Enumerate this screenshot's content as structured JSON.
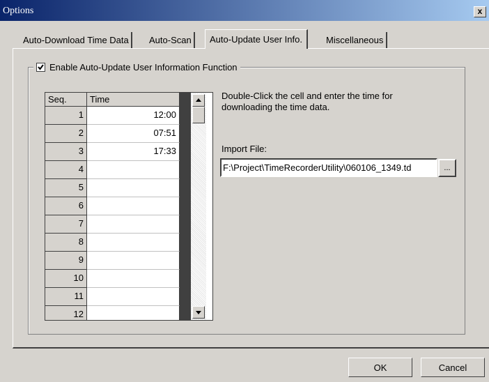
{
  "window": {
    "title": "Options",
    "close_label": "x"
  },
  "tabs": [
    {
      "label": "Auto-Download Time Data"
    },
    {
      "label": "Auto-Scan"
    },
    {
      "label": "Auto-Update User Info."
    },
    {
      "label": "Miscellaneous"
    }
  ],
  "active_tab": "Auto-Update User Info.",
  "group": {
    "label": "Enable Auto-Update User Information Function",
    "checked": true
  },
  "grid": {
    "headers": {
      "seq": "Seq.",
      "time": "Time"
    },
    "rows": [
      {
        "seq": "1",
        "time": "12:00"
      },
      {
        "seq": "2",
        "time": "07:51"
      },
      {
        "seq": "3",
        "time": "17:33"
      },
      {
        "seq": "4",
        "time": ""
      },
      {
        "seq": "5",
        "time": ""
      },
      {
        "seq": "6",
        "time": ""
      },
      {
        "seq": "7",
        "time": ""
      },
      {
        "seq": "8",
        "time": ""
      },
      {
        "seq": "9",
        "time": ""
      },
      {
        "seq": "10",
        "time": ""
      },
      {
        "seq": "11",
        "time": ""
      },
      {
        "seq": "12",
        "time": ""
      }
    ]
  },
  "hint": "Double-Click the cell and enter the time for downloading the time data.",
  "import": {
    "label": "Import File:",
    "value": "F:\\Project\\TimeRecorderUtility\\060106_1349.td",
    "browse_label": "..."
  },
  "buttons": {
    "ok": "OK",
    "cancel": "Cancel"
  }
}
